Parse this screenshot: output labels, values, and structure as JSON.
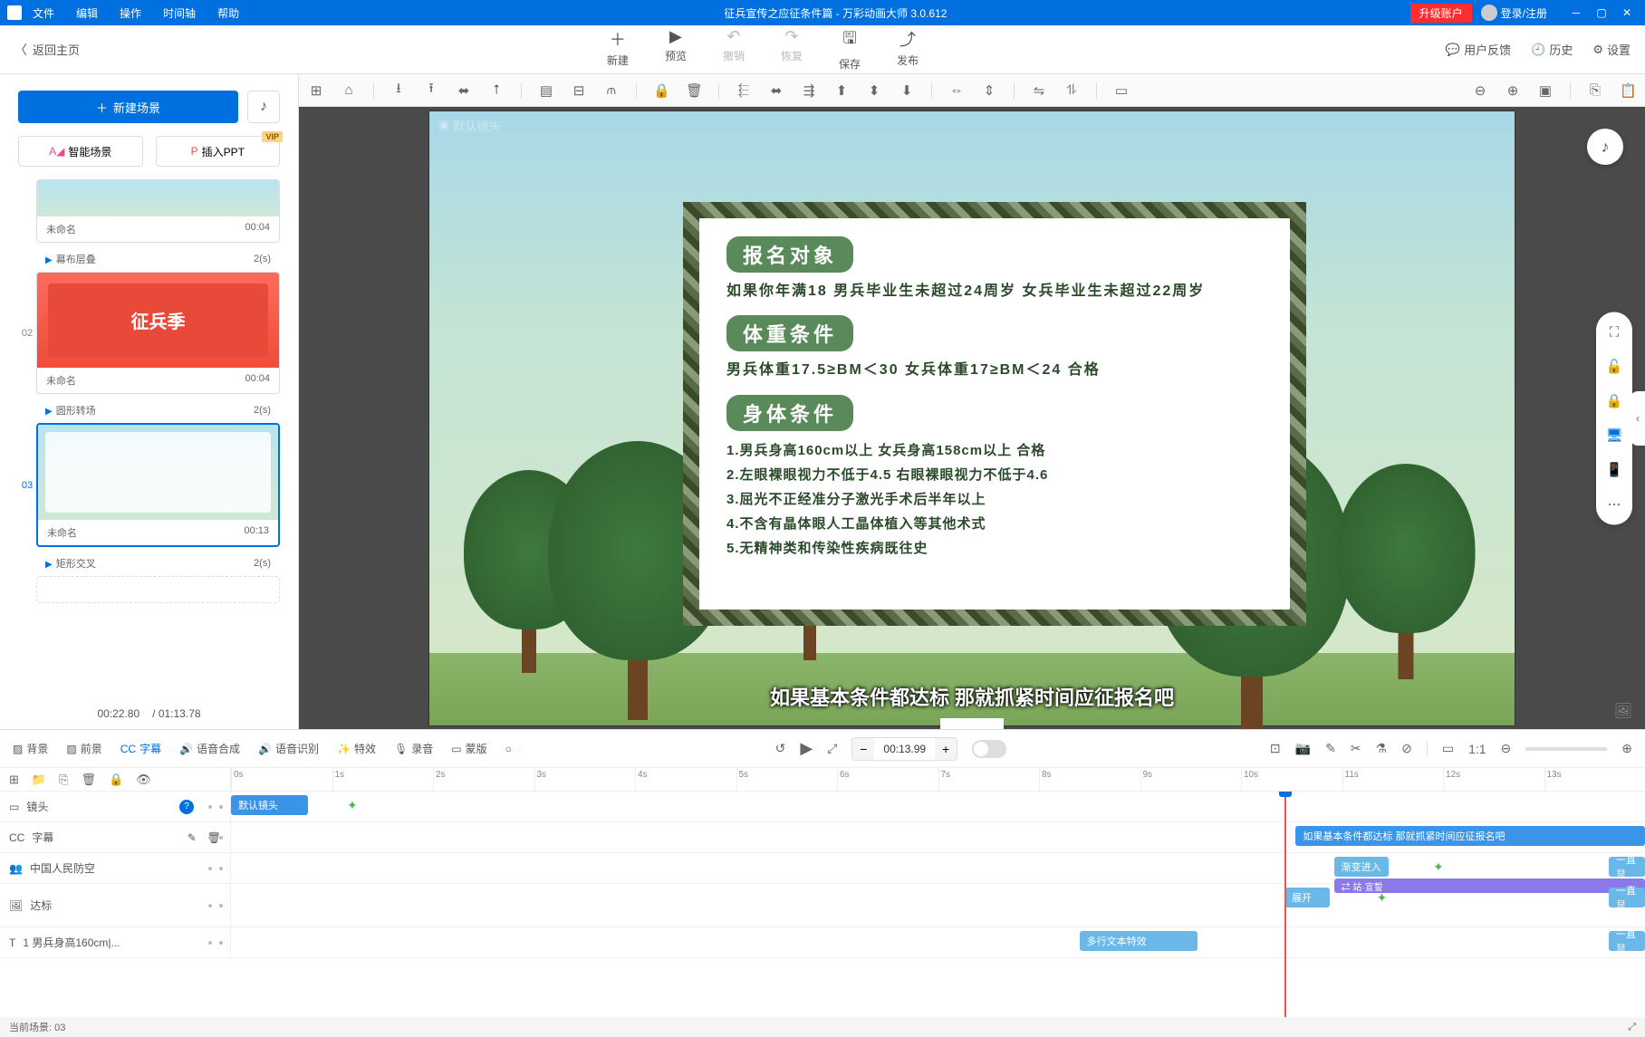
{
  "title_bar": {
    "menus": [
      "文件",
      "编辑",
      "操作",
      "时间轴",
      "帮助"
    ],
    "title": "征兵宣传之应征条件篇 - 万彩动画大师 3.0.612",
    "upgrade": "升级账户",
    "login": "登录/注册"
  },
  "main_toolbar": {
    "back": "返回主页",
    "buttons": [
      {
        "icon": "＋",
        "label": "新建"
      },
      {
        "icon": "▶",
        "label": "预览"
      },
      {
        "icon": "↶",
        "label": "撤销",
        "disabled": true
      },
      {
        "icon": "↷",
        "label": "恢复",
        "disabled": true
      },
      {
        "icon": "🖫",
        "label": "保存"
      },
      {
        "icon": "⤴",
        "label": "发布"
      }
    ],
    "right": [
      {
        "icon": "💬",
        "label": "用户反馈"
      },
      {
        "icon": "🕘",
        "label": "历史"
      },
      {
        "icon": "⚙",
        "label": "设置"
      }
    ]
  },
  "left_panel": {
    "new_scene": "新建场景",
    "smart_scene": "智能场景",
    "insert_ppt": "插入PPT",
    "vip": "VIP",
    "scenes": [
      {
        "num": "",
        "name": "未命名",
        "time": "00:04",
        "transition": "幕布层叠",
        "trans_time": "2(s)"
      },
      {
        "num": "02",
        "name": "未命名",
        "time": "00:04",
        "transition": "圆形转场",
        "trans_time": "2(s)",
        "red": true,
        "banner": "征兵季"
      },
      {
        "num": "03",
        "name": "未命名",
        "time": "00:13",
        "transition": "矩形交叉",
        "trans_time": "2(s)",
        "selected": true
      }
    ],
    "current_time": "00:22.80",
    "total_time": "/ 01:13.78"
  },
  "canvas": {
    "default_camera": "默认镜头",
    "card": {
      "section1_title": "报名对象",
      "section1_text": "如果你年满18 男兵毕业生未超过24周岁 女兵毕业生未超过22周岁",
      "section2_title": "体重条件",
      "section2_text": "男兵体重17.5≥BM＜30 女兵体重17≥BM＜24 合格",
      "section3_title": "身体条件",
      "section3_list": "1.男兵身高160cm以上 女兵身高158cm以上 合格\n2.左眼裸眼视力不低于4.5 右眼裸眼视力不低于4.6\n3.屈光不正经准分子激光手术后半年以上\n4.不含有晶体眼人工晶体植入等其他术式\n5.无精神类和传染性疾病既往史"
    },
    "subtitle": "如果基本条件都达标 那就抓紧时间应征报名吧"
  },
  "bottom": {
    "tabs": [
      {
        "icon": "▨",
        "label": "背景"
      },
      {
        "icon": "▨",
        "label": "前景"
      },
      {
        "icon": "CC",
        "label": "字幕",
        "active": true
      },
      {
        "icon": "🔊",
        "label": "语音合成"
      },
      {
        "icon": "🔊",
        "label": "语音识别"
      },
      {
        "icon": "✨",
        "label": "特效"
      },
      {
        "icon": "🎙",
        "label": "录音"
      },
      {
        "icon": "▭",
        "label": "蒙版"
      },
      {
        "icon": "○",
        "label": ""
      }
    ],
    "time": "00:13.99",
    "ruler": [
      "0s",
      "1s",
      "2s",
      "3s",
      "4s",
      "5s",
      "6s",
      "7s",
      "8s",
      "9s",
      "10s",
      "11s",
      "12s",
      "13s"
    ],
    "tracks": [
      {
        "icon": "▭",
        "label": "镜头",
        "help": true
      },
      {
        "icon": "CC",
        "label": "字幕"
      },
      {
        "icon": "👥",
        "label": "中国人民防空"
      },
      {
        "icon": "🖼",
        "label": "达标"
      },
      {
        "icon": "T",
        "label": "1 男兵身高160cm|..."
      }
    ],
    "clips": {
      "camera_default": "默认镜头",
      "subtitle_clip": "如果基本条件都达标 那就抓紧时间应征报名吧",
      "effect_in": "渐变进入",
      "effect_stay": "一直显",
      "effect_stay2": "一直显",
      "effect_stay3": "一直显",
      "station": "⇄ 站·宣誓",
      "expand": "展开",
      "multi_text": "多行文本特效"
    }
  },
  "status": {
    "current_scene": "当前场景: 03"
  }
}
